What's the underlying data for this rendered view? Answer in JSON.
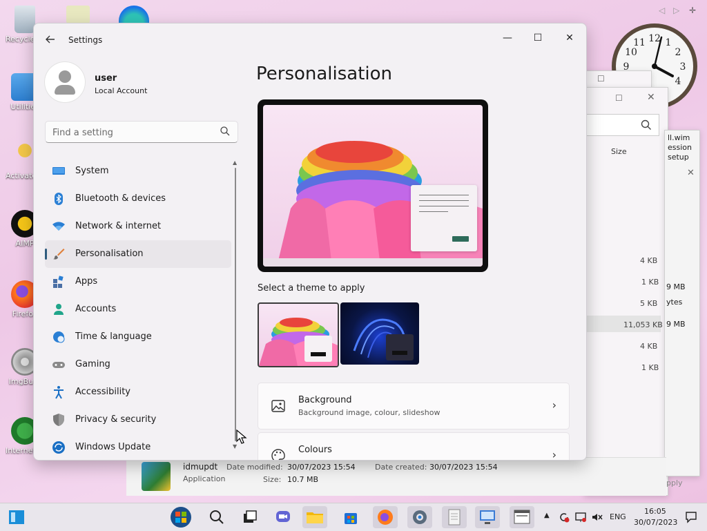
{
  "desktop": {
    "icons": [
      {
        "label": "Recycle Bin",
        "icon": "recycle-bin-icon"
      },
      {
        "label": "Utilities",
        "icon": "folder-icon"
      },
      {
        "label": "Activate Windows",
        "icon": "key-icon"
      },
      {
        "label": "AIMP",
        "icon": "aimp-icon"
      },
      {
        "label": "Firefox",
        "icon": "firefox-icon"
      },
      {
        "label": "ImgBurn",
        "icon": "imgburn-icon"
      },
      {
        "label": "Internet Download",
        "icon": "idm-icon"
      }
    ],
    "clock_gadget": {
      "hour": 4,
      "minute": 5
    }
  },
  "bg_explorer": {
    "column_size": "Size",
    "sizes": [
      "4 KB",
      "1 KB",
      "5 KB",
      "11,053 KB",
      "4 KB",
      "1 KB"
    ],
    "side_texts": [
      "ll.wim",
      "ession",
      "setup",
      "9 MB",
      "ytes",
      "9 MB"
    ],
    "apply_partial": "pply",
    "details": {
      "name": "idmupdt",
      "type": "Application",
      "date_modified_label": "Date modified:",
      "date_modified": "30/07/2023 15:54",
      "date_created_label": "Date created:",
      "date_created": "30/07/2023 15:54",
      "size_label": "Size:",
      "size": "10.7 MB"
    }
  },
  "settings": {
    "window_title": "Settings",
    "user": {
      "name": "user",
      "account_type": "Local Account"
    },
    "search": {
      "placeholder": "Find a setting"
    },
    "nav": [
      {
        "label": "System",
        "icon": "system-monitor-icon",
        "color": "#2a7fd4"
      },
      {
        "label": "Bluetooth & devices",
        "icon": "bluetooth-icon",
        "color": "#2a7fd4"
      },
      {
        "label": "Network & internet",
        "icon": "wifi-icon",
        "color": "#2a7fd4"
      },
      {
        "label": "Personalisation",
        "icon": "paintbrush-icon",
        "color": "#e0803a",
        "active": true
      },
      {
        "label": "Apps",
        "icon": "apps-icon",
        "color": "#4a6fa5"
      },
      {
        "label": "Accounts",
        "icon": "person-icon",
        "color": "#20a58a"
      },
      {
        "label": "Time & language",
        "icon": "globe-clock-icon",
        "color": "#2a7fd4"
      },
      {
        "label": "Gaming",
        "icon": "gamepad-icon",
        "color": "#7a7a7a"
      },
      {
        "label": "Accessibility",
        "icon": "accessibility-icon",
        "color": "#1a6fc4"
      },
      {
        "label": "Privacy & security",
        "icon": "shield-icon",
        "color": "#6b6b6b"
      },
      {
        "label": "Windows Update",
        "icon": "update-icon",
        "color": "#1a6fc4"
      }
    ],
    "content": {
      "title": "Personalisation",
      "theme_label": "Select a theme to apply",
      "cards": [
        {
          "title": "Background",
          "subtitle": "Background image, colour, slideshow",
          "icon": "image-icon"
        },
        {
          "title": "Colours",
          "subtitle": "",
          "icon": "palette-icon"
        }
      ]
    }
  },
  "taskbar": {
    "language": "ENG",
    "time": "16:05",
    "date": "30/07/2023"
  },
  "colors": {
    "accent": "#2f5c7e"
  }
}
